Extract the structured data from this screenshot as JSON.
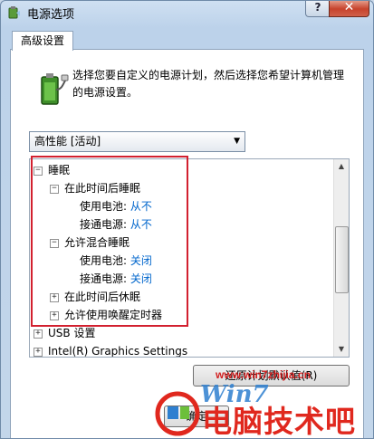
{
  "window": {
    "title": "电源选项",
    "help": "?",
    "close": "✕"
  },
  "tab": {
    "label": "高级设置"
  },
  "description": "选择您要自定义的电源计划，然后选择您希望计算机管理的电源设置。",
  "plan_select": {
    "value": "高性能 [活动]"
  },
  "tree": {
    "sleep": {
      "expander": "−",
      "label": "睡眠"
    },
    "sleep_after": {
      "expander": "−",
      "label": "在此时间后睡眠"
    },
    "sleep_after_battery": {
      "label": "使用电池:",
      "value": "从不"
    },
    "sleep_after_plugged": {
      "label": "接通电源:",
      "value": "从不"
    },
    "hybrid": {
      "expander": "−",
      "label": "允许混合睡眠"
    },
    "hybrid_battery": {
      "label": "使用电池:",
      "value": "关闭"
    },
    "hybrid_plugged": {
      "label": "接通电源:",
      "value": "关闭"
    },
    "hibernate_after": {
      "expander": "+",
      "label": "在此时间后休眠"
    },
    "wake_timers": {
      "expander": "+",
      "label": "允许使用唤醒定时器"
    },
    "usb": {
      "expander": "+",
      "label": "USB 设置"
    },
    "intel": {
      "expander": "+",
      "label": "Intel(R) Graphics Settings"
    }
  },
  "buttons": {
    "restore": "还原计划默认值(R)",
    "ok": "确定"
  },
  "watermark": {
    "url": "www.win7zhijia.cn",
    "brand": "Win7",
    "big_text": "电脑技术吧"
  },
  "colors": {
    "highlight_box": "#d2202f",
    "link_value": "#0066cc"
  }
}
